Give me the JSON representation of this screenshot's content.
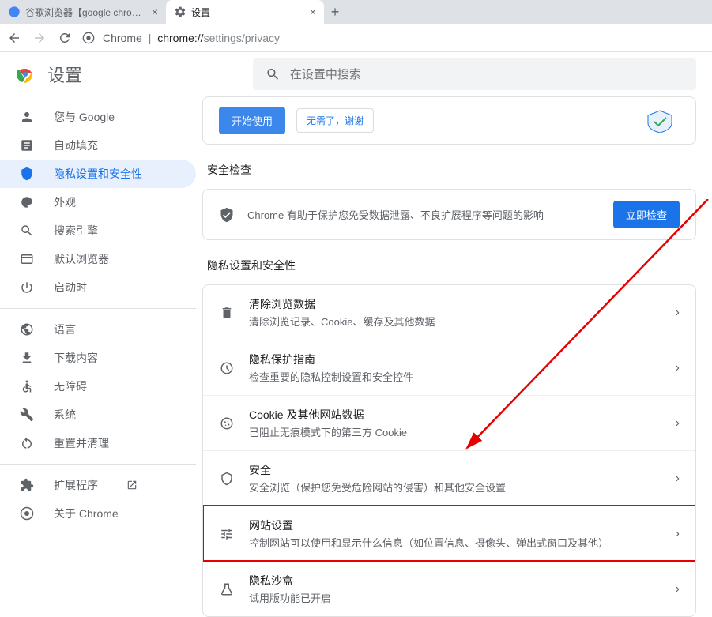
{
  "tabs": [
    {
      "title": "谷歌浏览器【google chrome】",
      "active": false
    },
    {
      "title": "设置",
      "active": true
    }
  ],
  "url_bar": {
    "prefix": "Chrome",
    "sep": "|",
    "url_dark": "chrome://",
    "url_light": "settings/privacy"
  },
  "header": {
    "title": "设置",
    "search_placeholder": "在设置中搜索"
  },
  "sidebar": {
    "items": [
      {
        "label": "您与 Google",
        "icon": "person"
      },
      {
        "label": "自动填充",
        "icon": "autofill"
      },
      {
        "label": "隐私设置和安全性",
        "icon": "shield",
        "active": true
      },
      {
        "label": "外观",
        "icon": "palette"
      },
      {
        "label": "搜索引擎",
        "icon": "search"
      },
      {
        "label": "默认浏览器",
        "icon": "browser"
      },
      {
        "label": "启动时",
        "icon": "power"
      }
    ],
    "items2": [
      {
        "label": "语言",
        "icon": "globe"
      },
      {
        "label": "下载内容",
        "icon": "download"
      },
      {
        "label": "无障碍",
        "icon": "accessibility"
      },
      {
        "label": "系统",
        "icon": "wrench"
      },
      {
        "label": "重置并清理",
        "icon": "reset"
      }
    ],
    "items3": [
      {
        "label": "扩展程序",
        "icon": "extension",
        "ext": true
      },
      {
        "label": "关于 Chrome",
        "icon": "chrome"
      }
    ]
  },
  "top_card": {
    "btn1": "开始使用",
    "btn2": "无需了，谢谢"
  },
  "safety": {
    "heading": "安全检查",
    "text": "Chrome 有助于保护您免受数据泄露、不良扩展程序等问题的影响",
    "button": "立即检查"
  },
  "privacy": {
    "heading": "隐私设置和安全性",
    "rows": [
      {
        "title": "清除浏览数据",
        "sub": "清除浏览记录、Cookie、缓存及其他数据",
        "icon": "trash"
      },
      {
        "title": "隐私保护指南",
        "sub": "检查重要的隐私控制设置和安全控件",
        "icon": "guide"
      },
      {
        "title": "Cookie 及其他网站数据",
        "sub": "已阻止无痕模式下的第三方 Cookie",
        "icon": "cookie"
      },
      {
        "title": "安全",
        "sub": "安全浏览（保护您免受危险网站的侵害）和其他安全设置",
        "icon": "security"
      },
      {
        "title": "网站设置",
        "sub": "控制网站可以使用和显示什么信息（如位置信息、摄像头、弹出式窗口及其他）",
        "icon": "tune",
        "highlight": true
      },
      {
        "title": "隐私沙盒",
        "sub": "试用版功能已开启",
        "icon": "sandbox"
      }
    ]
  }
}
